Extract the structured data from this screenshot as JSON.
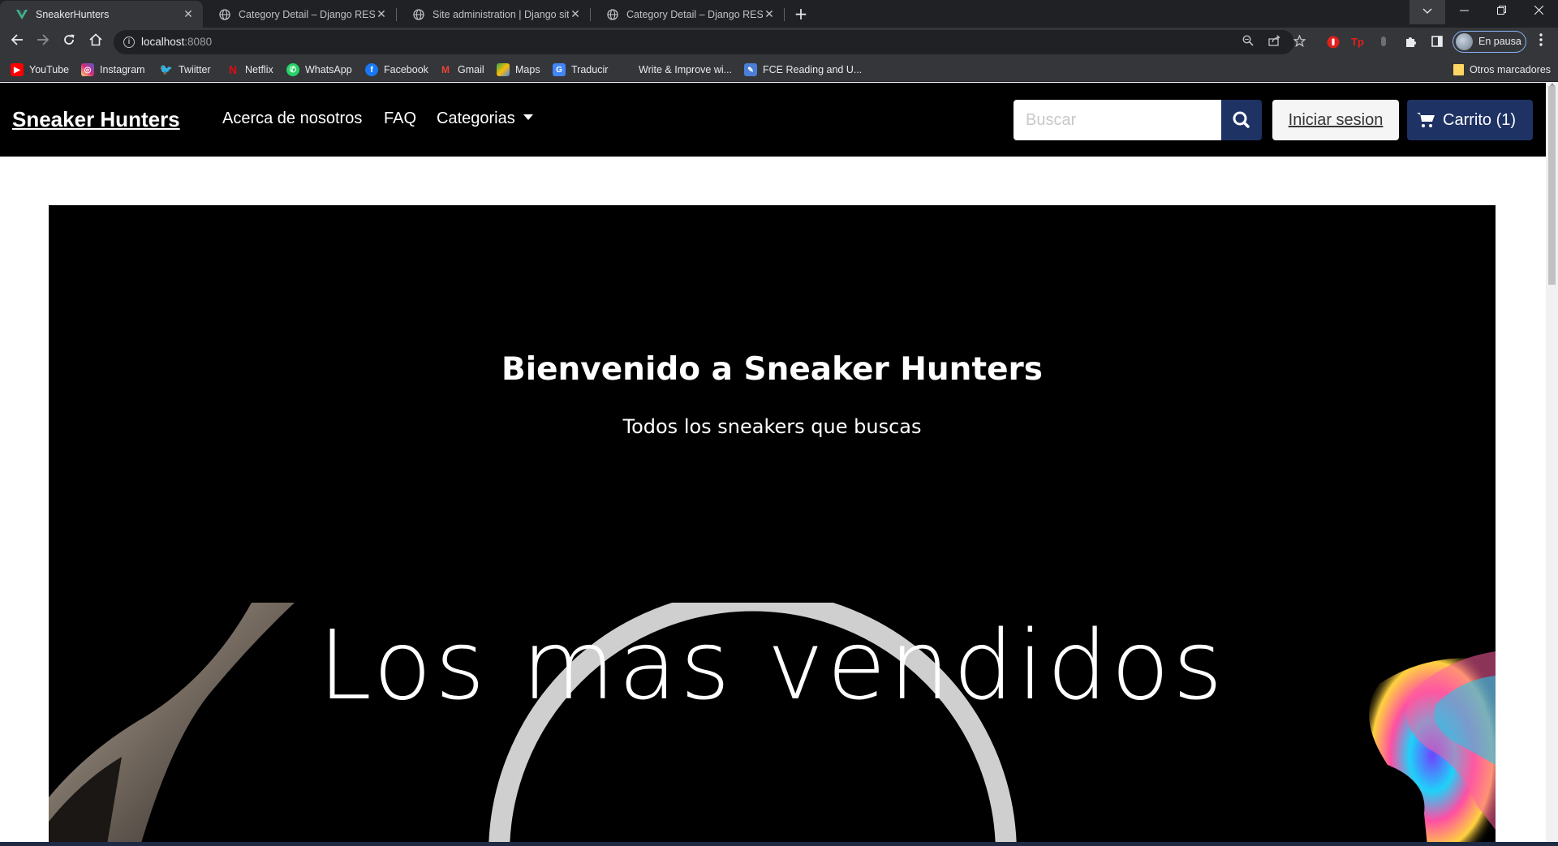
{
  "browser": {
    "tabs": [
      {
        "title": "SneakerHunters",
        "active": true
      },
      {
        "title": "Category Detail – Django REST fr",
        "active": false
      },
      {
        "title": "Site administration | Django site",
        "active": false
      },
      {
        "title": "Category Detail – Django REST fr",
        "active": false
      }
    ],
    "url_host": "localhost",
    "url_port": ":8080",
    "profile_label": "En pausa",
    "bookmarks": [
      {
        "label": "YouTube",
        "icon": "youtube-icon",
        "color": "#ff0000"
      },
      {
        "label": "Instagram",
        "icon": "instagram-icon",
        "color": "#d6249f"
      },
      {
        "label": "Twiitter",
        "icon": "twitter-icon",
        "color": "#1da1f2"
      },
      {
        "label": "Netflix",
        "icon": "netflix-icon",
        "color": "#e50914"
      },
      {
        "label": "WhatsApp",
        "icon": "whatsapp-icon",
        "color": "#25d366"
      },
      {
        "label": "Facebook",
        "icon": "facebook-icon",
        "color": "#1877f2"
      },
      {
        "label": "Gmail",
        "icon": "gmail-icon",
        "color": "#ea4335"
      },
      {
        "label": "Maps",
        "icon": "maps-icon",
        "color": "#34a853"
      },
      {
        "label": "Traducir",
        "icon": "translate-icon",
        "color": "#4285f4"
      },
      {
        "label": "Write & Improve wi...",
        "icon": "write-improve-icon",
        "color": "#35363a"
      },
      {
        "label": "FCE Reading and U...",
        "icon": "fce-icon",
        "color": "#4a7fd6"
      }
    ],
    "other_bookmarks": "Otros marcadores"
  },
  "site": {
    "brand": "Sneaker Hunters",
    "nav": {
      "about": "Acerca de nosotros",
      "faq": "FAQ",
      "categories": "Categorias"
    },
    "search_placeholder": "Buscar",
    "login_label": "Iniciar sesion",
    "cart_label": "Carrito (1)",
    "accent_color": "#1e3264"
  },
  "hero": {
    "title": "Bienvenido a Sneaker Hunters",
    "subtitle": "Todos los sneakers que buscas",
    "banner_text": "Los mas vendidos"
  }
}
